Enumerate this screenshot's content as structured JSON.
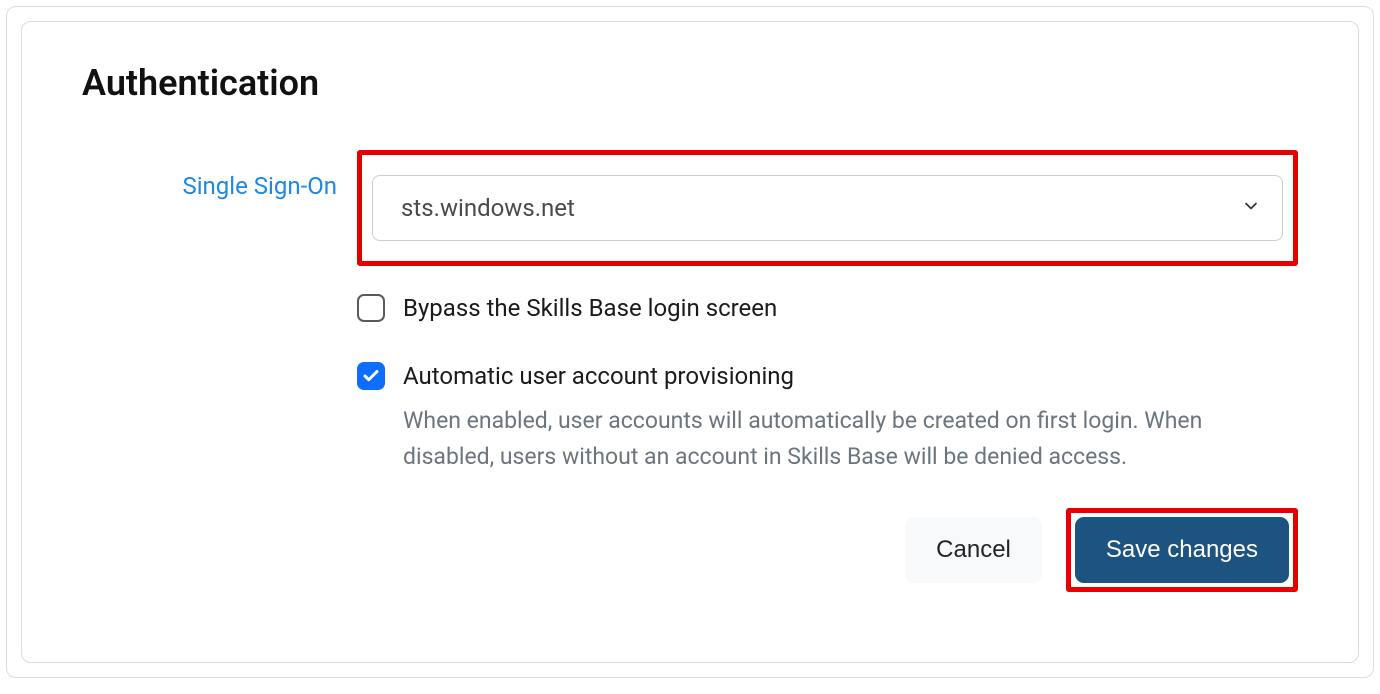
{
  "page": {
    "title": "Authentication"
  },
  "form": {
    "sso": {
      "label": "Single Sign-On",
      "selected": "sts.windows.net"
    },
    "bypass": {
      "label": "Bypass the Skills Base login screen",
      "checked": false
    },
    "auto_provision": {
      "label": "Automatic user account provisioning",
      "helper": "When enabled, user accounts will automatically be created on first login. When disabled, users without an account in Skills Base will be denied access.",
      "checked": true
    }
  },
  "buttons": {
    "cancel": "Cancel",
    "save": "Save changes"
  }
}
